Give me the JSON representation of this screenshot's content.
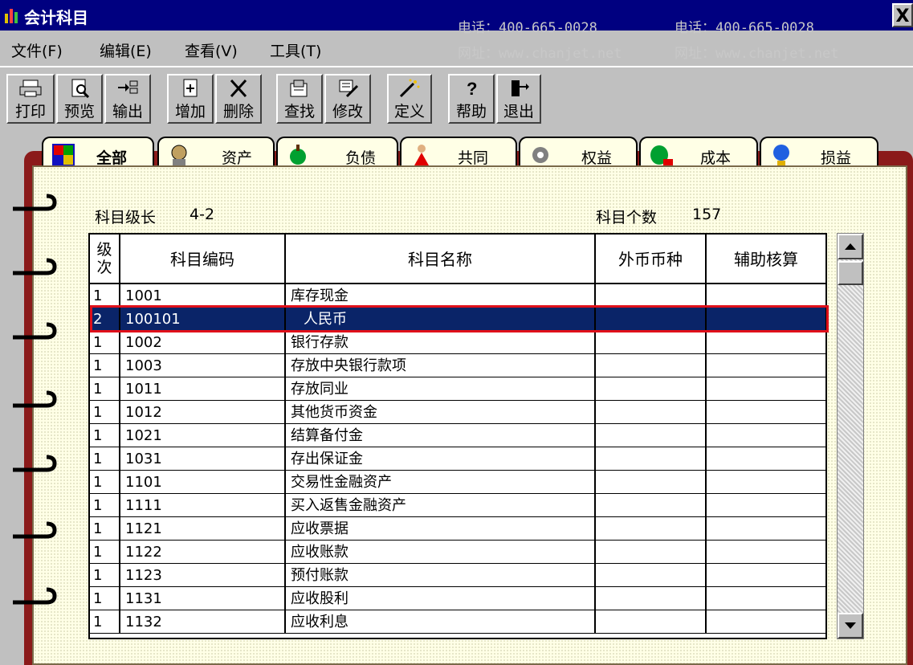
{
  "window": {
    "title": "会计科目",
    "close_label": "X"
  },
  "menu": [
    "文件(F)",
    "编辑(E)",
    "查看(V)",
    "工具(T)"
  ],
  "toolbar": [
    "打印",
    "预览",
    "输出",
    "增加",
    "删除",
    "查找",
    "修改",
    "定义",
    "帮助",
    "退出"
  ],
  "tabs": [
    {
      "label": "全部",
      "active": true,
      "icon": "all-icon"
    },
    {
      "label": "资产",
      "icon": "asset-icon"
    },
    {
      "label": "负债",
      "icon": "liability-icon"
    },
    {
      "label": "共同",
      "icon": "common-icon"
    },
    {
      "label": "权益",
      "icon": "equity-icon"
    },
    {
      "label": "成本",
      "icon": "cost-icon"
    },
    {
      "label": "损益",
      "icon": "profit-loss-icon"
    }
  ],
  "info": {
    "level_label": "科目级长",
    "level_value": "4-2",
    "count_label": "科目个数",
    "count_value": "157"
  },
  "table": {
    "headers": [
      "级次",
      "科目编码",
      "科目名称",
      "外币币种",
      "辅助核算"
    ],
    "rows": [
      {
        "level": "1",
        "code": "1001",
        "name": "库存现金",
        "currency": "",
        "aux": ""
      },
      {
        "level": "2",
        "code": "100101",
        "name": "人民币",
        "currency": "",
        "aux": "",
        "selected": true
      },
      {
        "level": "1",
        "code": "1002",
        "name": "银行存款",
        "currency": "",
        "aux": ""
      },
      {
        "level": "1",
        "code": "1003",
        "name": "存放中央银行款项",
        "currency": "",
        "aux": ""
      },
      {
        "level": "1",
        "code": "1011",
        "name": "存放同业",
        "currency": "",
        "aux": ""
      },
      {
        "level": "1",
        "code": "1012",
        "name": "其他货币资金",
        "currency": "",
        "aux": ""
      },
      {
        "level": "1",
        "code": "1021",
        "name": "结算备付金",
        "currency": "",
        "aux": ""
      },
      {
        "level": "1",
        "code": "1031",
        "name": "存出保证金",
        "currency": "",
        "aux": ""
      },
      {
        "level": "1",
        "code": "1101",
        "name": "交易性金融资产",
        "currency": "",
        "aux": ""
      },
      {
        "level": "1",
        "code": "1111",
        "name": "买入返售金融资产",
        "currency": "",
        "aux": ""
      },
      {
        "level": "1",
        "code": "1121",
        "name": "应收票据",
        "currency": "",
        "aux": ""
      },
      {
        "level": "1",
        "code": "1122",
        "name": "应收账款",
        "currency": "",
        "aux": ""
      },
      {
        "level": "1",
        "code": "1123",
        "name": "预付账款",
        "currency": "",
        "aux": ""
      },
      {
        "level": "1",
        "code": "1131",
        "name": "应收股利",
        "currency": "",
        "aux": ""
      },
      {
        "level": "1",
        "code": "1132",
        "name": "应收利息",
        "currency": "",
        "aux": ""
      }
    ]
  },
  "watermark": {
    "phone": "电话：400-665-0028",
    "site": "网址：www.chanjet.net"
  },
  "colors": {
    "titlebar": "#000080",
    "selected_row": "#0a2468",
    "highlight_box": "#e0101a",
    "spine": "#8b1a1a"
  }
}
